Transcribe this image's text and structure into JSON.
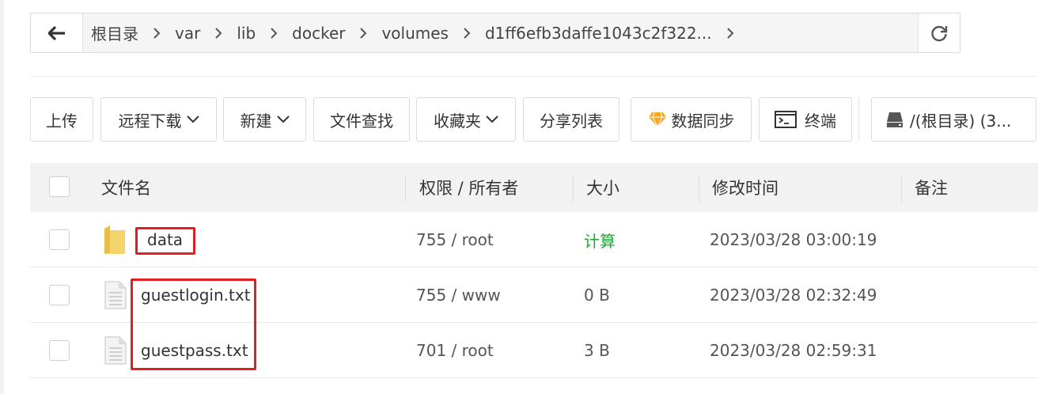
{
  "path": {
    "crumbs": [
      "根目录",
      "var",
      "lib",
      "docker",
      "volumes",
      "d1ff6efb3daffe1043c2f322..."
    ]
  },
  "toolbar": {
    "upload": "上传",
    "remote_download": "远程下载",
    "new": "新建",
    "file_search": "文件查找",
    "favorites": "收藏夹",
    "share_list": "分享列表",
    "data_sync": "数据同步",
    "terminal": "终端",
    "disk": "/(根目录) (3..."
  },
  "table": {
    "headers": {
      "name": "文件名",
      "perm": "权限 / 所有者",
      "size": "大小",
      "mtime": "修改时间",
      "remark": "备注"
    },
    "rows": [
      {
        "type": "folder",
        "name": "data",
        "perm": "755 / root",
        "size": "计算",
        "mtime": "2023/03/28 03:00:19",
        "remark": ""
      },
      {
        "type": "file",
        "name": "guestlogin.txt",
        "perm": "755 / www",
        "size": "0 B",
        "mtime": "2023/03/28 02:32:49",
        "remark": ""
      },
      {
        "type": "file",
        "name": "guestpass.txt",
        "perm": "701 / root",
        "size": "3 B",
        "mtime": "2023/03/28 02:59:31",
        "remark": ""
      }
    ]
  },
  "colors": {
    "highlight": "#e02020",
    "calc_link": "#20a53a",
    "diamond": "#f5a623"
  },
  "icons": [
    "back-arrow-icon",
    "chevron-right-icon",
    "refresh-icon",
    "chevron-down-icon",
    "diamond-icon",
    "terminal-icon",
    "disk-icon",
    "folder-icon",
    "file-icon"
  ]
}
